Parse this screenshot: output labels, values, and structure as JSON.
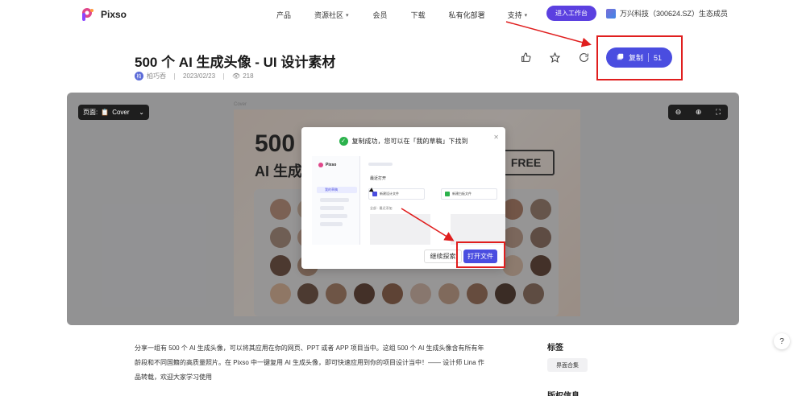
{
  "header": {
    "logo_text": "Pixso",
    "nav": [
      {
        "label": "产品",
        "has_menu": false
      },
      {
        "label": "资源社区",
        "has_menu": true
      },
      {
        "label": "会员",
        "has_menu": false
      },
      {
        "label": "下载",
        "has_menu": false
      },
      {
        "label": "私有化部署",
        "has_menu": false
      },
      {
        "label": "支持",
        "has_menu": true
      }
    ],
    "workbench_button": "进入工作台",
    "partner_text": "万兴科技（300624.SZ）生态成员"
  },
  "resource": {
    "title": "500 个 AI 生成头像 - UI 设计素材",
    "author_initial": "柏",
    "author": "柏巧吞",
    "date": "2023/02/23",
    "views": "218",
    "copy_label": "复制",
    "copy_count": "51"
  },
  "preview": {
    "page_label": "页面:",
    "page_name": "Cover",
    "cover_label": "Cover",
    "cover_title_1": "500",
    "cover_title_2": "AI 生成",
    "free_label": "FREE"
  },
  "modal": {
    "message": "复制成功，您可以在「我的草稿」下找到",
    "shot": {
      "logo": "Pixso",
      "recent": "最近打开",
      "card1": "新建设计文件",
      "card2": "新建白板文件",
      "sidebar_item": "我的草稿",
      "list_header": "全部 · 最近添加"
    },
    "continue_label": "继续探索",
    "open_label": "打开文件"
  },
  "description": {
    "text": "分享一组有 500 个 AI 生成头像，可以将其应用在你的网页、PPT 或者 APP 项目当中。这组 500 个 AI 生成头像含有所有年龄段和不同国籍的高质量照片。在 Pixso 中一键复用 AI 生成头像，即可快速应用到你的项目设计当中！—— 设计师 Lina 作品转载，欢迎大家学习使用"
  },
  "sidebar_info": {
    "tags_title": "标签",
    "tags": [
      "界面合集"
    ],
    "license_title": "版权信息"
  },
  "help_label": "?",
  "colors": {
    "brand": "#4a4de0",
    "highlight": "#e01e1e",
    "success": "#2bb24c"
  }
}
